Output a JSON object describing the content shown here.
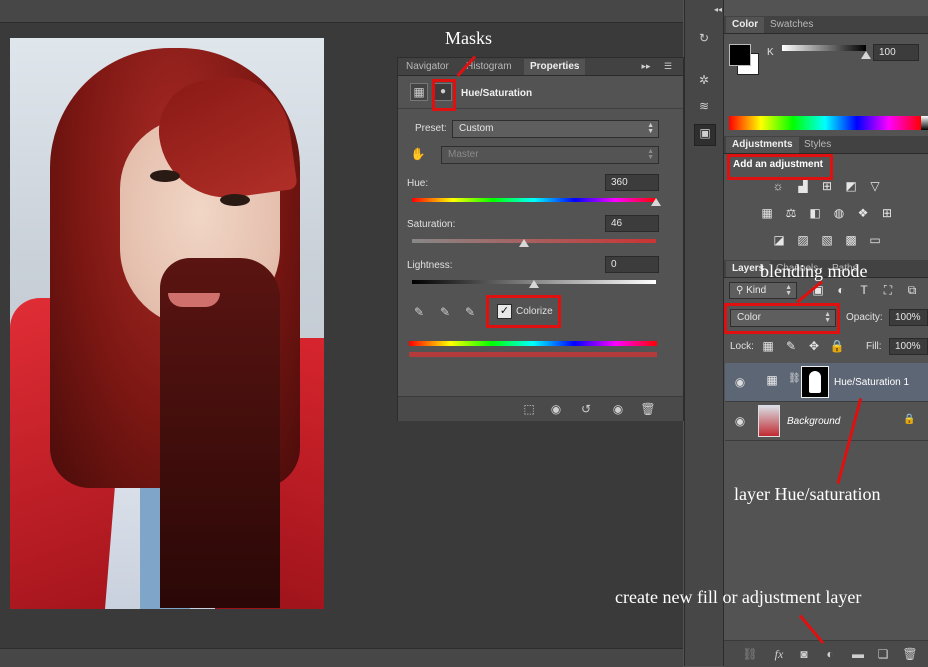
{
  "annotations": {
    "masks": "Masks",
    "blending_mode": "blending mode",
    "layer_hue_saturation": "layer Hue/saturation",
    "create_new_fill": "create new fill or adjustment layer"
  },
  "properties_panel": {
    "tabs": [
      "Navigator",
      "Histogram",
      "Properties"
    ],
    "header_title": "Hue/Saturation",
    "preset_label": "Preset:",
    "preset_value": "Custom",
    "channel_value": "Master",
    "hue_label": "Hue:",
    "hue_value": "360",
    "hue_level": 1.0,
    "saturation_label": "Saturation:",
    "saturation_value": "46",
    "saturation_level": 0.46,
    "lightness_label": "Lightness:",
    "lightness_value": "0",
    "lightness_level": 0.5,
    "colorize_label": "Colorize",
    "colorize_checked": true
  },
  "color_panel": {
    "tabs": [
      "Color",
      "Swatches"
    ],
    "channel_label": "K",
    "value": "100"
  },
  "adjustments_panel": {
    "tabs": [
      "Adjustments",
      "Styles"
    ],
    "title": "Add an adjustment"
  },
  "layers_panel": {
    "tabs": [
      "Layers",
      "Channels",
      "Paths"
    ],
    "kind_label": "Kind",
    "blend_mode": "Color",
    "opacity_label": "Opacity:",
    "opacity_value": "100%",
    "lock_label": "Lock:",
    "fill_label": "Fill:",
    "fill_value": "100%",
    "layers": [
      {
        "name": "Hue/Saturation 1"
      },
      {
        "name": "Background"
      }
    ]
  },
  "colors": {
    "annotation_red": "#e01010",
    "panel_bg": "#535353",
    "canvas_bg": "#3a3a3a"
  }
}
